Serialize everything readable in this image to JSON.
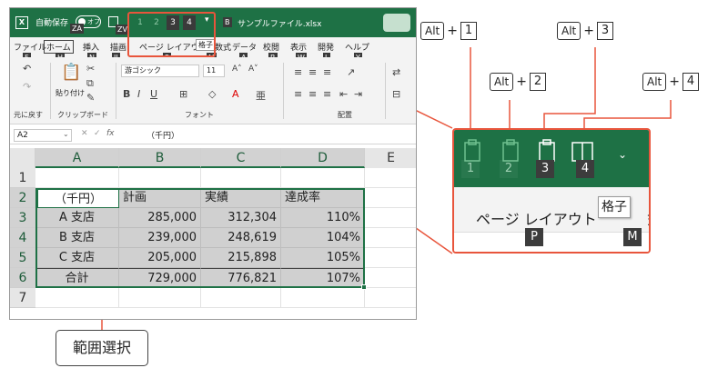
{
  "titlebar": {
    "autosave_label": "自動保存",
    "autosave_state": "オフ",
    "autosave_keytip": "ZA",
    "save_keytip": "ZV",
    "qa_keys": [
      "1",
      "2",
      "3",
      "4"
    ],
    "filename_keytip": "B",
    "filename": "サンプルファイル.xlsx"
  },
  "tabs": [
    {
      "label": "ファイル",
      "keytip": "F"
    },
    {
      "label": "ホーム",
      "keytip": "H"
    },
    {
      "label": "挿入",
      "keytip": "N"
    },
    {
      "label": "描画",
      "keytip": "JI"
    },
    {
      "label": "ページ レイアウト",
      "keytip": "P"
    },
    {
      "label": "数式",
      "keytip": "M"
    },
    {
      "label": "データ",
      "keytip": "A"
    },
    {
      "label": "校閲",
      "keytip": "R"
    },
    {
      "label": "表示",
      "keytip": "W"
    },
    {
      "label": "開発",
      "keytip": "L"
    },
    {
      "label": "ヘルプ",
      "keytip": "Y"
    }
  ],
  "tooltip_small": "格子",
  "ribbon": {
    "undo_group": "元に戻す",
    "clipboard_group": "クリップボード",
    "paste_label": "貼り付け",
    "font_group": "フォント",
    "align_group": "配置",
    "font_name": "游ゴシック",
    "font_size": "11"
  },
  "formula_bar": {
    "name_box": "A2",
    "fx": "fx",
    "value": "（千円）"
  },
  "sheet": {
    "columns": [
      "A",
      "B",
      "C",
      "D",
      "E"
    ],
    "rows": [
      "1",
      "2",
      "3",
      "4",
      "5",
      "6",
      "7"
    ],
    "cells": [
      [
        "（千円）",
        "計画",
        "実績",
        "達成率"
      ],
      [
        "A 支店",
        "285,000",
        "312,304",
        "110%"
      ],
      [
        "B 支店",
        "239,000",
        "248,619",
        "104%"
      ],
      [
        "C 支店",
        "205,000",
        "215,898",
        "105%"
      ],
      [
        "合計",
        "729,000",
        "776,821",
        "107%"
      ]
    ]
  },
  "shortcuts": [
    {
      "key": "Alt",
      "plus": "+",
      "num": "1"
    },
    {
      "key": "Alt",
      "plus": "+",
      "num": "2"
    },
    {
      "key": "Alt",
      "plus": "+",
      "num": "3"
    },
    {
      "key": "Alt",
      "plus": "+",
      "num": "4"
    }
  ],
  "zoom": {
    "keys": [
      "1",
      "2",
      "3",
      "4"
    ],
    "tab_text": "ページ レイアウト",
    "tooltip": "格子",
    "trail": "式",
    "keytip_p": "P",
    "keytip_m": "M"
  },
  "callout_range": "範囲選択",
  "colors": {
    "excel_green": "#1e7145",
    "callout_red": "#e8553c",
    "keytip_bg": "#3a3a3a"
  }
}
